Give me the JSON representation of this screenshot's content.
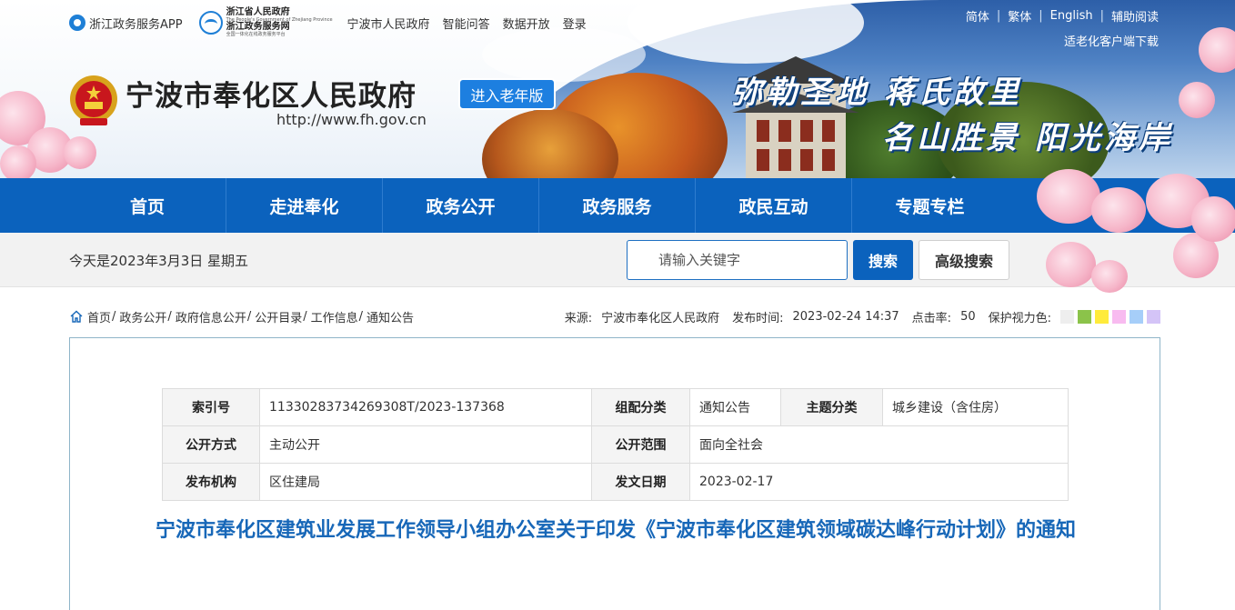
{
  "header": {
    "app_label": "浙江政务服务APP",
    "zj_logo": {
      "line1": "浙江省人民政府",
      "line2": "The People's Government of Zhejiang Province",
      "line3": "浙江政务服务网",
      "line4": "全国一体化在线政务服务平台"
    },
    "top_links": [
      "宁波市人民政府",
      "智能问答",
      "数据开放",
      "登录"
    ],
    "lang_links": [
      "简体",
      "繁体",
      "English",
      "辅助阅读"
    ],
    "elder_download": "适老化客户端下载",
    "site_title": "宁波市奉化区人民政府",
    "site_url": "http://www.fh.gov.cn",
    "elder_button": "进入老年版",
    "slogan_line1": "弥勒圣地 蒋氏故里",
    "slogan_line2": "名山胜景 阳光海岸"
  },
  "nav": {
    "items": [
      "首页",
      "走进奉化",
      "政务公开",
      "政务服务",
      "政民互动",
      "专题专栏"
    ]
  },
  "infobar": {
    "today": "今天是2023年3月3日  星期五",
    "search_placeholder": "请输入关键字",
    "search_button": "搜索",
    "advanced_button": "高级搜索"
  },
  "breadcrumb": {
    "items": [
      "首页",
      "政务公开",
      "政府信息公开",
      "公开目录",
      "工作信息",
      "通知公告"
    ]
  },
  "meta": {
    "source_label": "来源:",
    "source_value": "宁波市奉化区人民政府",
    "time_label": "发布时间:",
    "time_value": "2023-02-24 14:37",
    "hits_label": "点击率:",
    "hits_value": "50",
    "eye_label": "保护视力色:",
    "eye_colors": [
      "#eeeeee",
      "#8bc34a",
      "#ffeb3b",
      "#f8bbf0",
      "#a6cef9",
      "#d4c4f7"
    ]
  },
  "info_table": {
    "rows": [
      [
        {
          "k": "索引号",
          "v": "11330283734269308T/2023-137368"
        },
        {
          "k": "组配分类",
          "v": "通知公告"
        },
        {
          "k": "主题分类",
          "v": "城乡建设（含住房）"
        }
      ],
      [
        {
          "k": "公开方式",
          "v": "主动公开"
        },
        {
          "k": "公开范围",
          "v": "面向全社会"
        }
      ],
      [
        {
          "k": "发布机构",
          "v": "区住建局"
        },
        {
          "k": "发文日期",
          "v": "2023-02-17"
        }
      ]
    ]
  },
  "doc": {
    "title": "宁波市奉化区建筑业发展工作领导小组办公室关于印发《宁波市奉化区建筑领域碳达峰行动计划》的通知"
  }
}
